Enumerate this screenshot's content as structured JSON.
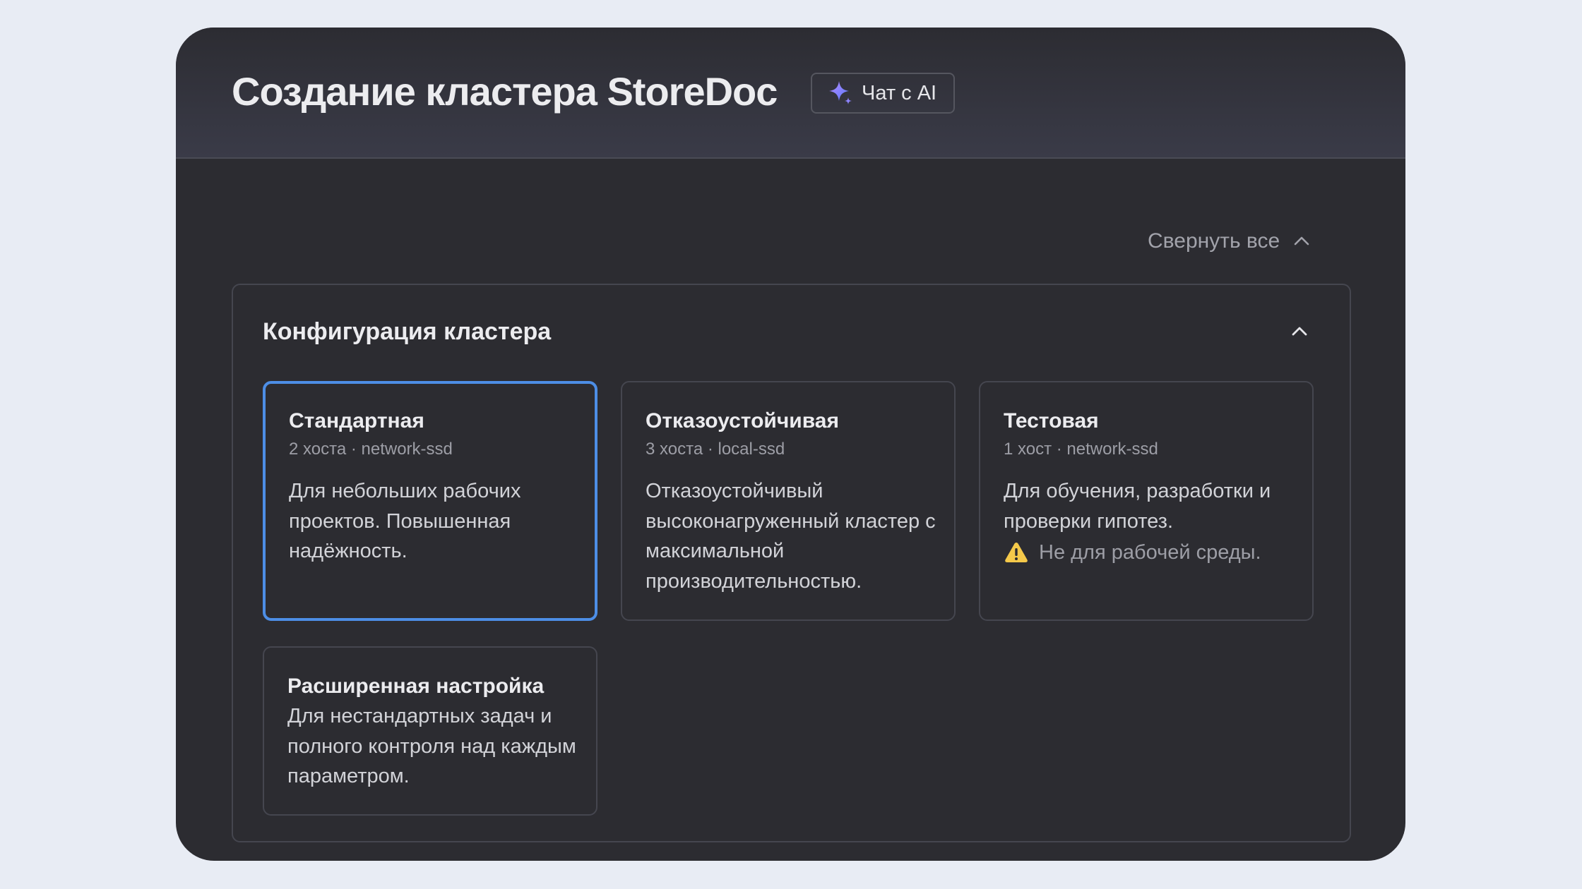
{
  "header": {
    "title": "Создание кластера StoreDoc",
    "ai_button_label": "Чат с AI",
    "ai_icon": "sparkle-icon"
  },
  "toolbar": {
    "collapse_all_label": "Свернуть все",
    "collapse_all_icon": "chevron-up-icon"
  },
  "section": {
    "title": "Конфигурация кластера",
    "expanded": true,
    "cards": [
      {
        "title": "Стандартная",
        "subtitle": "2 хоста · network-ssd",
        "description": "Для небольших рабочих проектов. Повышенная надёжность.",
        "selected": true
      },
      {
        "title": "Отказоустойчивая",
        "subtitle": "3 хоста · local-ssd",
        "description": "Отказоустойчивый высоконагруженный кластер с максимальной производительностью.",
        "selected": false
      },
      {
        "title": "Тестовая",
        "subtitle": "1 хост · network-ssd",
        "description": "Для обучения, разработки и проверки гипотез.",
        "warning": "Не для рабочей среды.",
        "warning_icon": "warning-icon",
        "selected": false
      },
      {
        "title": "Расширенная настройка",
        "description": "Для нестандартных задач и полного контроля над каждым параметром.",
        "selected": false
      }
    ]
  },
  "colors": {
    "page_background": "#e8ecf4",
    "window_background": "#2c2c31",
    "selected_border": "#4d8ee6",
    "warning_yellow": "#f5c94a",
    "sparkle_gradient": [
      "#a98bff",
      "#5a7bff"
    ]
  }
}
